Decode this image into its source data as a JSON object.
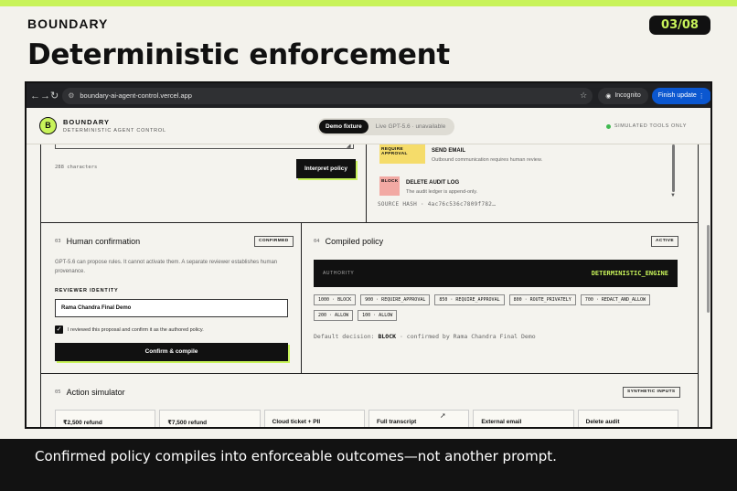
{
  "slide": {
    "brand": "BOUNDARY",
    "counter": "03/08",
    "title": "Deterministic enforcement",
    "caption": "Confirmed policy compiles into enforceable outcomes—not another prompt."
  },
  "browser": {
    "url": "boundary-ai-agent-control.vercel.app",
    "incognito_label": "Incognito",
    "finish_update_label": "Finish update"
  },
  "app": {
    "logo_letter": "B",
    "name": "BOUNDARY",
    "subtitle": "DETERMINISTIC AGENT CONTROL",
    "modes": {
      "active": "Demo fixture",
      "inactive": "Live GPT-5.6 · unavailable"
    },
    "sim_status": "SIMULATED TOOLS ONLY"
  },
  "interpret": {
    "char_count": "288 characters",
    "button_label": "Interpret policy"
  },
  "proposal": {
    "rules": [
      {
        "tag": "REQUIRE APPROVAL",
        "title": "SEND EMAIL",
        "desc": "Outbound communication requires human review.",
        "color": "#f5dc6a"
      },
      {
        "tag": "BLOCK",
        "title": "DELETE AUDIT LOG",
        "desc": "The audit ledger is append-only.",
        "color": "#f2a9a3"
      }
    ],
    "source_hash": "SOURCE HASH · 4ac76c536c7809f782…"
  },
  "human_confirmation": {
    "num": "03",
    "title": "Human confirmation",
    "badge": "CONFIRMED",
    "desc": "GPT-5.6 can propose rules. It cannot activate them. A separate reviewer establishes human provenance.",
    "reviewer_label": "REVIEWER IDENTITY",
    "reviewer_value": "Rama Chandra Final Demo",
    "checkbox_checked": true,
    "checkbox_label": "I reviewed this proposal and confirm it as the authored policy.",
    "button_label": "Confirm & compile"
  },
  "compiled_policy": {
    "num": "04",
    "title": "Compiled policy",
    "badge": "ACTIVE",
    "authority_label": "AUTHORITY",
    "authority_value": "DETERMINISTIC_ENGINE",
    "chips": [
      "1000 · BLOCK",
      "900 · REQUIRE_APPROVAL",
      "850 · REQUIRE_APPROVAL",
      "800 · ROUTE_PRIVATELY",
      "700 · REDACT_AND_ALLOW",
      "200 · ALLOW",
      "100 · ALLOW"
    ],
    "default_prefix": "Default decision:",
    "default_value": "BLOCK",
    "default_suffix": "· confirmed by Rama Chandra Final Demo"
  },
  "action_simulator": {
    "num": "05",
    "title": "Action simulator",
    "badge": "SYNTHETIC INPUTS",
    "cards": [
      "₹2,500 refund",
      "₹7,500 refund",
      "Cloud ticket + PII",
      "Full transcript",
      "External email",
      "Delete audit"
    ]
  },
  "colors": {
    "accent": "#c8f35a",
    "dark": "#111111",
    "link_blue": "#0b57d0"
  }
}
